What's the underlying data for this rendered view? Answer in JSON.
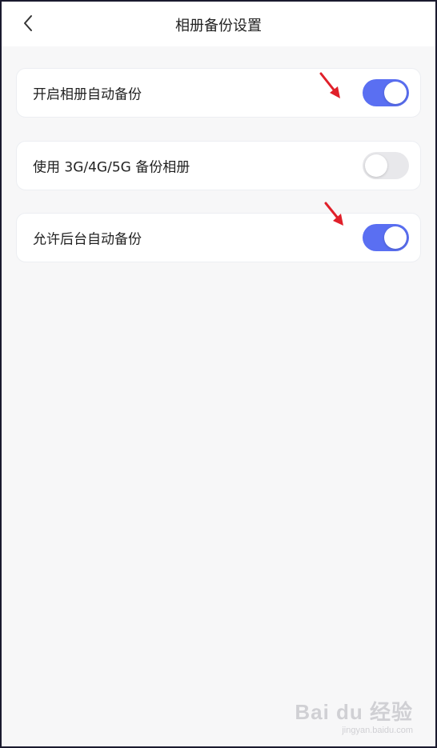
{
  "header": {
    "title": "相册备份设置",
    "back_icon": "chevron-left-icon"
  },
  "settings": [
    {
      "label": "开启相册自动备份",
      "enabled": true
    },
    {
      "label": "使用 3G/4G/5G 备份相册",
      "enabled": false
    },
    {
      "label": "允许后台自动备份",
      "enabled": true
    }
  ],
  "colors": {
    "toggle_on": "#5a6ff2",
    "toggle_off": "#e8e8eb",
    "annotation_arrow": "#e0202a"
  },
  "watermark": {
    "main": "Bai du 经验",
    "sub": "jingyan.baidu.com"
  }
}
